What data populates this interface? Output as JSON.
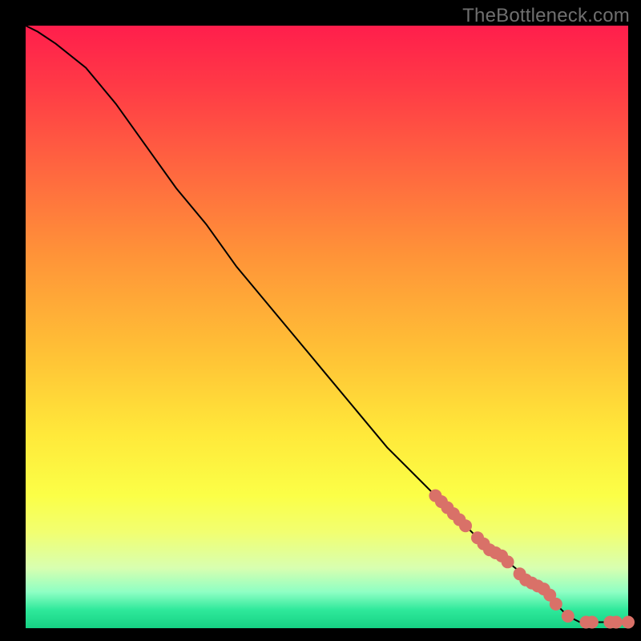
{
  "watermark": "TheBottleneck.com",
  "colors": {
    "line": "#000000",
    "marker": "#d97168",
    "background_black": "#000000"
  },
  "chart_data": {
    "type": "line",
    "title": "",
    "xlabel": "",
    "ylabel": "",
    "xlim": [
      0,
      100
    ],
    "ylim": [
      0,
      100
    ],
    "grid": false,
    "legend": false,
    "series": [
      {
        "name": "bottleneck-curve",
        "x": [
          0,
          2,
          5,
          10,
          15,
          20,
          25,
          30,
          35,
          40,
          45,
          50,
          55,
          60,
          65,
          70,
          75,
          80,
          85,
          88,
          90,
          92,
          94,
          96,
          98,
          100
        ],
        "y": [
          100,
          99,
          97,
          93,
          87,
          80,
          73,
          67,
          60,
          54,
          48,
          42,
          36,
          30,
          25,
          20,
          15,
          11,
          7,
          4,
          2,
          1,
          1,
          1,
          1,
          1
        ]
      }
    ],
    "markers": {
      "name": "highlighted-points",
      "x": [
        68,
        69,
        70,
        71,
        72,
        73,
        75,
        76,
        77,
        78,
        79,
        80,
        82,
        83,
        84,
        85,
        86,
        87,
        88,
        90,
        93,
        94,
        97,
        98,
        100
      ],
      "y": [
        22,
        21,
        20,
        19,
        18,
        17,
        15,
        14,
        13,
        12.5,
        12,
        11,
        9,
        8,
        7.5,
        7,
        6.5,
        5.5,
        4,
        2,
        1,
        1,
        1,
        1,
        1
      ],
      "color": "#d97168",
      "radius": 8
    }
  }
}
